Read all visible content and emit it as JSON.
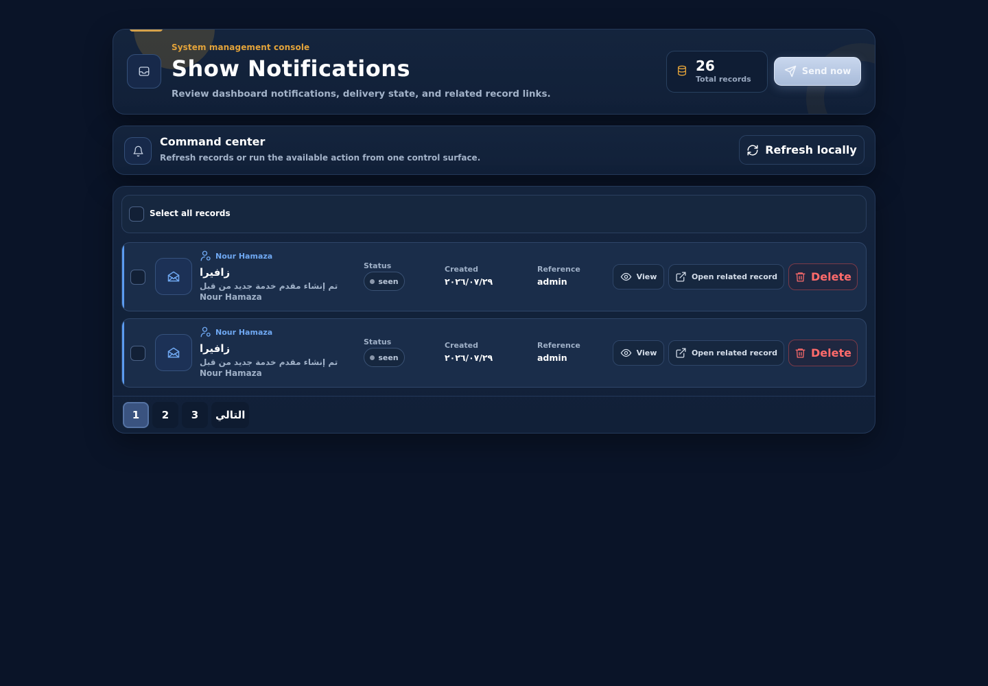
{
  "header": {
    "eyebrow": "System management console",
    "title": "Show Notifications",
    "subtitle": "Review dashboard notifications, delivery state, and related record links.",
    "stat_value": "26",
    "stat_label": "Total records",
    "send_label": "Send now"
  },
  "command": {
    "title": "Command center",
    "subtitle": "Refresh records or run the available action from one control surface.",
    "refresh_label": "Refresh locally"
  },
  "list": {
    "select_all_label": "Select all records",
    "rows": [
      {
        "sender": "Nour Hamaza",
        "title": "زافيرا",
        "body": "تم إنشاء مقدم خدمة جديد من قبل Nour Hamaza",
        "status_label": "Status",
        "status": "seen",
        "created_label": "Created",
        "created": "٢٠٢٦/٠٧/٢٩",
        "reference_label": "Reference",
        "reference": "admin",
        "view_label": "View",
        "open_label": "Open related record",
        "delete_label": "Delete"
      },
      {
        "sender": "Nour Hamaza",
        "title": "زافيرا",
        "body": "تم إنشاء مقدم خدمة جديد من قبل Nour Hamaza",
        "status_label": "Status",
        "status": "seen",
        "created_label": "Created",
        "created": "٢٠٢٦/٠٧/٢٩",
        "reference_label": "Reference",
        "reference": "admin",
        "view_label": "View",
        "open_label": "Open related record",
        "delete_label": "Delete"
      }
    ]
  },
  "pagination": {
    "pages": [
      "1",
      "2",
      "3"
    ],
    "active": "1",
    "next_label": "التالي"
  },
  "colors": {
    "background": "#0a1428",
    "accent_orange": "#e3a33a",
    "accent_blue": "#5b9bf0",
    "danger": "#ff6b6b"
  },
  "icons": {
    "header": "inbox-icon",
    "stat": "database-icon",
    "send": "send-icon",
    "command": "bell-icon",
    "refresh": "refresh-icon",
    "row": "mail-open-icon",
    "sender": "user-icon",
    "view": "eye-icon",
    "open": "external-link-icon",
    "delete": "trash-icon"
  }
}
